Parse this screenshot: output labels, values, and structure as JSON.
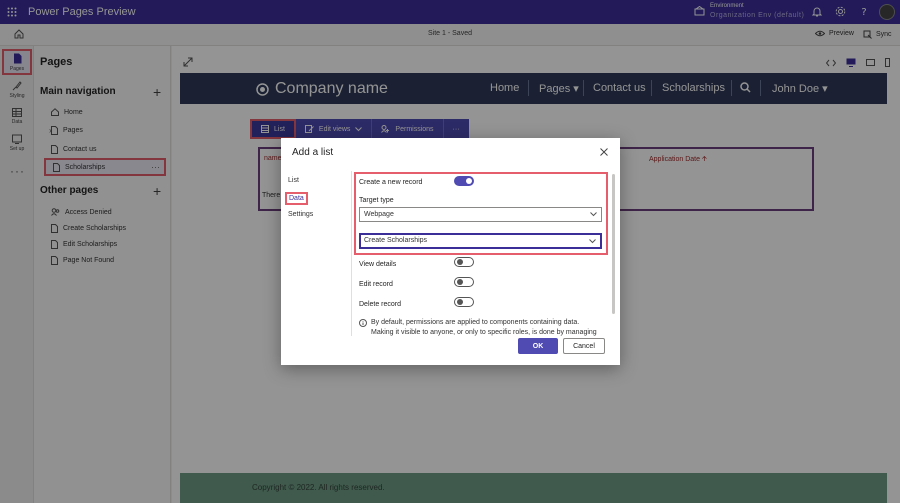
{
  "app": {
    "title": "Power Pages Preview"
  },
  "environment": {
    "label": "Environment",
    "name": "Organization Env (default)"
  },
  "subbar": {
    "site_status": "Site 1 - Saved",
    "preview_label": "Preview",
    "sync_label": "Sync"
  },
  "rail": {
    "items": [
      {
        "label": "Pages"
      },
      {
        "label": "Styling"
      },
      {
        "label": "Data"
      },
      {
        "label": "Set up"
      }
    ],
    "more": "···"
  },
  "panel": {
    "title": "Pages",
    "main_nav_title": "Main navigation",
    "main_nav": [
      {
        "label": "Home"
      },
      {
        "label": "Pages"
      },
      {
        "label": "Contact us"
      },
      {
        "label": "Scholarships"
      }
    ],
    "other_title": "Other pages",
    "other_pages": [
      {
        "label": "Access Denied"
      },
      {
        "label": "Create Scholarships"
      },
      {
        "label": "Edit Scholarships"
      },
      {
        "label": "Page Not Found"
      }
    ],
    "item_more": "···"
  },
  "site": {
    "company": "Company name",
    "nav": [
      {
        "label": "Home"
      },
      {
        "label": "Pages ▾"
      },
      {
        "label": "Contact us"
      },
      {
        "label": "Scholarships"
      },
      {
        "label": "John Doe ▾"
      }
    ]
  },
  "list_toolbar": {
    "list": "List",
    "edit_views": "Edit views",
    "permissions": "Permissions",
    "more": "···"
  },
  "list": {
    "col_name": "name",
    "col_app_date": "Application Date 🡩",
    "row_text": "There"
  },
  "footer": {
    "text": "Copyright © 2022. All rights reserved."
  },
  "dialog": {
    "title": "Add a list",
    "tabs": [
      {
        "label": "List"
      },
      {
        "label": "Data"
      },
      {
        "label": "Settings"
      }
    ],
    "create_new_record": "Create a new record",
    "target_type_label": "Target type",
    "target_type_value": "Webpage",
    "target_page_value": "Create Scholarships",
    "view_details": "View details",
    "edit_record": "Edit record",
    "delete_record": "Delete record",
    "info": "By default, permissions are applied to components containing data. Making it visible to anyone, or only to specific roles, is done by managing",
    "ok": "OK",
    "cancel": "Cancel"
  },
  "colors": {
    "brand": "#3b2e99",
    "accent": "#4f4bb2",
    "highlight": "#e45e6c",
    "site_header": "#2f3a59",
    "footer": "#6e9c86"
  }
}
